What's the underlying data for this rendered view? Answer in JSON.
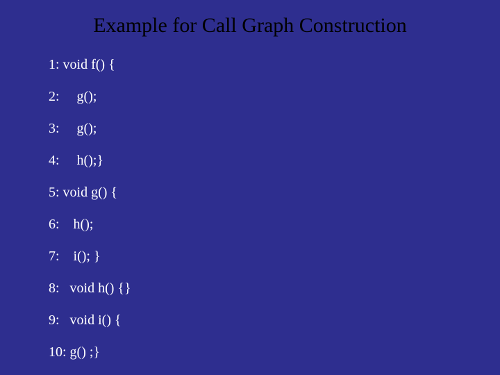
{
  "title": "Example for Call Graph Construction",
  "lines": {
    "l1": "1: void f() {",
    "l2": "2:     g();",
    "l3": "3:     g();",
    "l4": "4:     h();}",
    "l5": "5: void g() {",
    "l6": "6:    h();",
    "l7": "7:    i(); }",
    "l8": "8:   void h() {}",
    "l9": "9:   void i() {",
    "l10": "10: g() ;}"
  }
}
